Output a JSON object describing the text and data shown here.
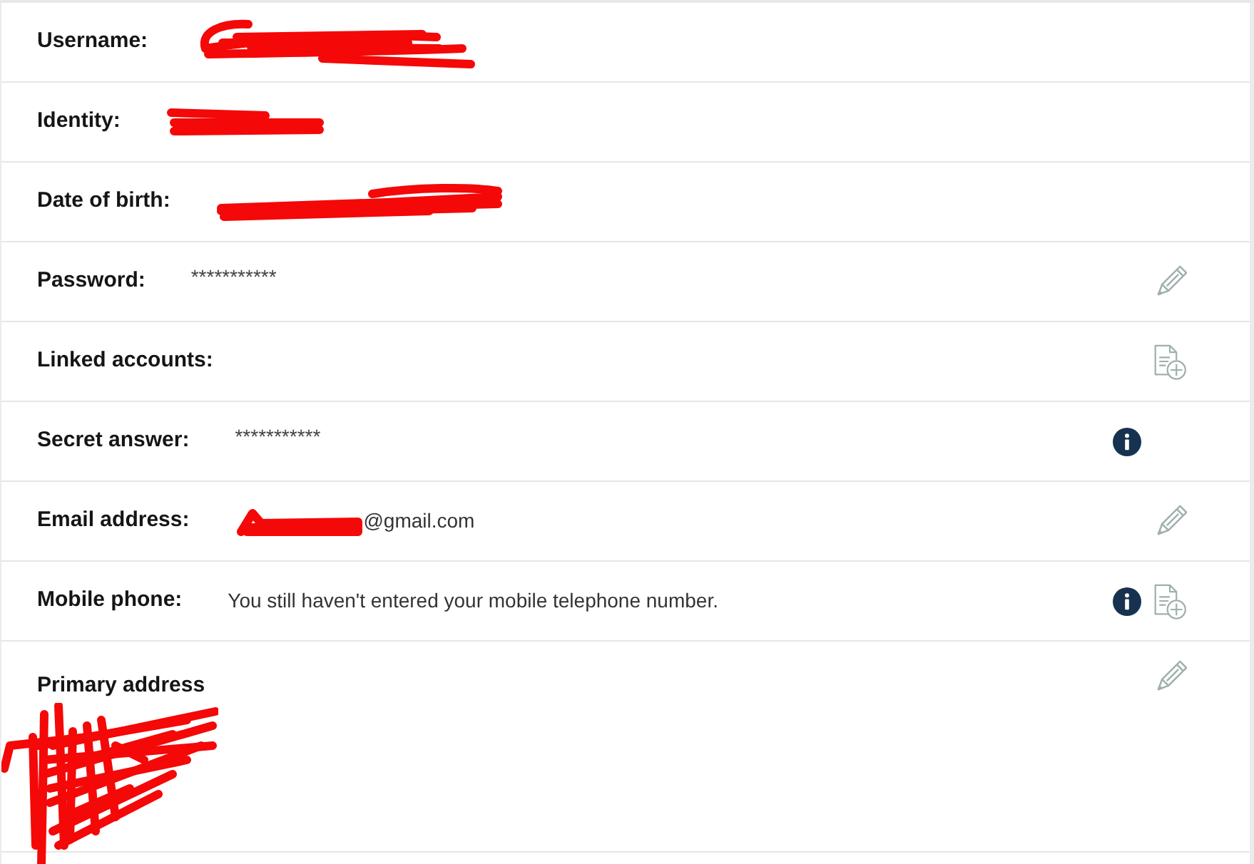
{
  "fields": [
    {
      "kind": "inline",
      "label": "Username:",
      "redacted": true
    },
    {
      "kind": "inline",
      "label": "Identity:",
      "redacted": true
    },
    {
      "kind": "inline",
      "label": "Date of birth:",
      "redacted": true
    },
    {
      "kind": "inline",
      "label": "Password:",
      "value": "***********",
      "masked": true,
      "icons": [
        {
          "kind": "edit"
        }
      ]
    },
    {
      "kind": "inline",
      "label": "Linked accounts:",
      "icons": [
        {
          "kind": "add"
        }
      ]
    },
    {
      "kind": "inline",
      "label": "Secret answer:",
      "value": "***********",
      "masked": true,
      "icons": [
        {
          "kind": "info"
        }
      ]
    },
    {
      "kind": "inline",
      "label": "Email address:",
      "redacted": true,
      "value": "@gmail.com",
      "icons": [
        {
          "kind": "edit"
        }
      ]
    },
    {
      "kind": "inline",
      "label": "Mobile phone:",
      "value": "You still haven't entered your mobile telephone number.",
      "icons": [
        {
          "kind": "info"
        },
        {
          "kind": "add"
        }
      ]
    },
    {
      "kind": "stacked",
      "label": "Primary address",
      "redacted": true,
      "icons": [
        {
          "kind": "edit"
        }
      ]
    }
  ]
}
